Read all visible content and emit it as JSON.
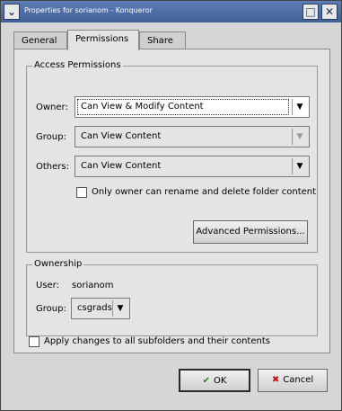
{
  "window": {
    "title": "Properties for sorianom - Konqueror"
  },
  "tabs": [
    {
      "label": "General"
    },
    {
      "label": "Permissions"
    },
    {
      "label": "Share"
    }
  ],
  "access": {
    "title": "Access Permissions",
    "owner_label": "Owner:",
    "owner_value": "Can View & Modify Content",
    "group_label": "Group:",
    "group_value": "Can View Content",
    "others_label": "Others:",
    "others_value": "Can View Content",
    "only_owner_label": "Only owner can rename and delete folder content",
    "advanced_button": "Advanced Permissions..."
  },
  "ownership": {
    "title": "Ownership",
    "user_label": "User:",
    "user_value": "sorianom",
    "group_label": "Group:",
    "group_value": "csgrads"
  },
  "apply_subfolders_label": "Apply changes to all subfolders and their contents",
  "buttons": {
    "ok": "OK",
    "cancel": "Cancel"
  },
  "colors": {
    "titlebar": "#4a6aa3",
    "ok_check": "#1e8a1e",
    "cancel_x": "#cc1111"
  }
}
